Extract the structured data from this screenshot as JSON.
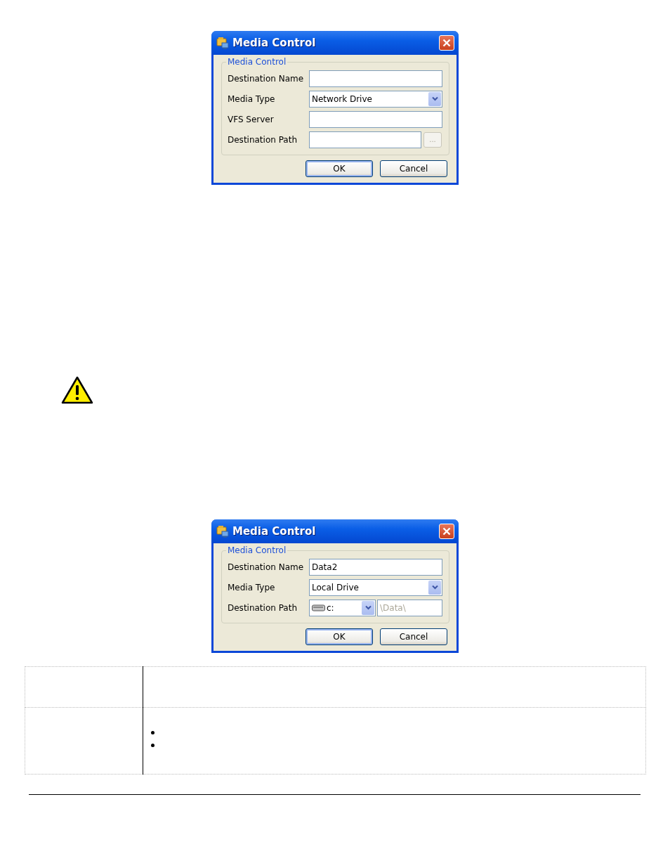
{
  "dialogs": [
    {
      "title": "Media Control",
      "group_title": "Media Control",
      "rows": [
        {
          "kind": "text",
          "label": "Destination Name"
        },
        {
          "kind": "combo",
          "label": "Media Type",
          "value": "Network Drive"
        },
        {
          "kind": "text",
          "label": "VFS Server"
        },
        {
          "kind": "browse",
          "label": "Destination Path",
          "browse_label": "...",
          "browse_disabled": true
        }
      ],
      "buttons": [
        "OK",
        "Cancel"
      ]
    },
    {
      "title": "Media Control",
      "group_title": "Media Control",
      "rows": [
        {
          "kind": "text",
          "label": "Destination Name",
          "value": "Data2"
        },
        {
          "kind": "combo",
          "label": "Media Type",
          "value": "Local Drive"
        },
        {
          "kind": "drive",
          "label": "Destination Path",
          "drive": "c:",
          "placeholder": "\\Data\\"
        }
      ],
      "buttons": [
        "OK",
        "Cancel"
      ]
    }
  ],
  "table": {
    "rows": [
      {
        "kind": "plain"
      },
      {
        "kind": "bullets"
      }
    ]
  }
}
